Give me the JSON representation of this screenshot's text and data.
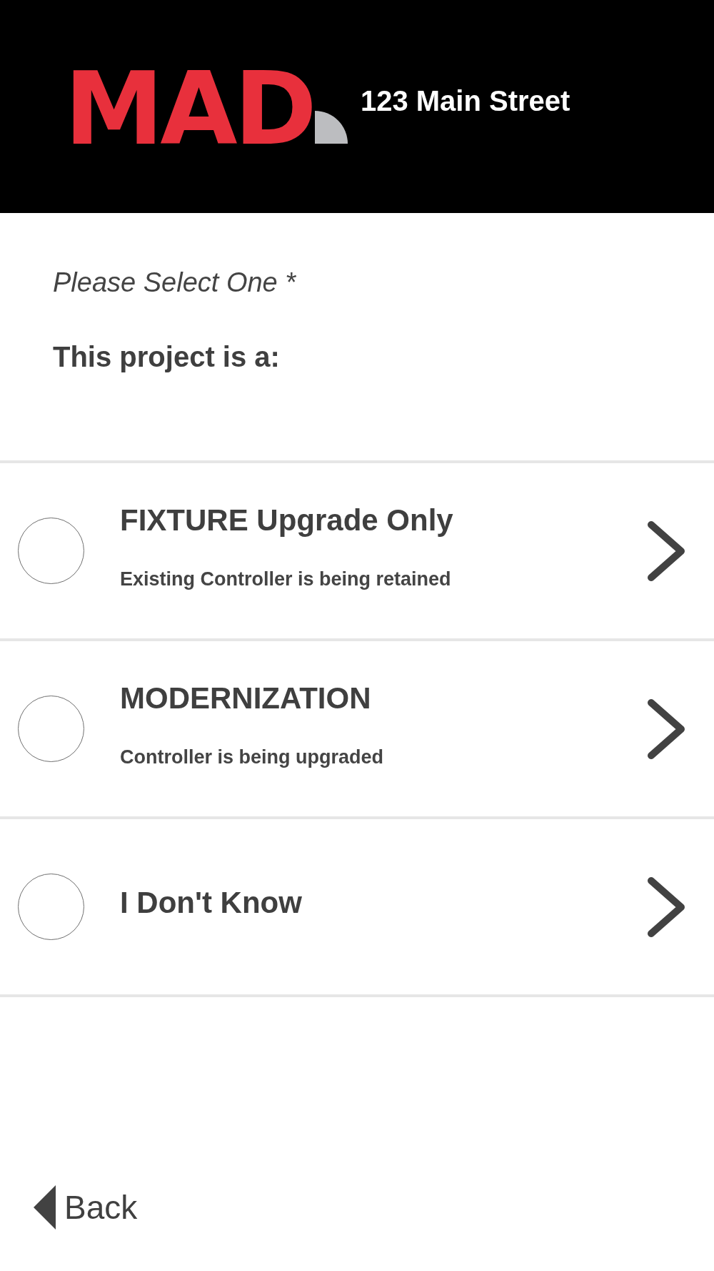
{
  "header": {
    "logo_text": "MAD",
    "address": "123 Main Street"
  },
  "prompt": {
    "hint": "Please Select One *",
    "question": "This project is a:"
  },
  "options": [
    {
      "title": "FIXTURE Upgrade Only",
      "subtitle": "Existing Controller is being retained",
      "selected": false
    },
    {
      "title": "MODERNIZATION",
      "subtitle": "Controller is being upgraded",
      "selected": false
    },
    {
      "title": "I Don't Know",
      "selected": false
    }
  ],
  "back_button": {
    "label": "Back"
  }
}
